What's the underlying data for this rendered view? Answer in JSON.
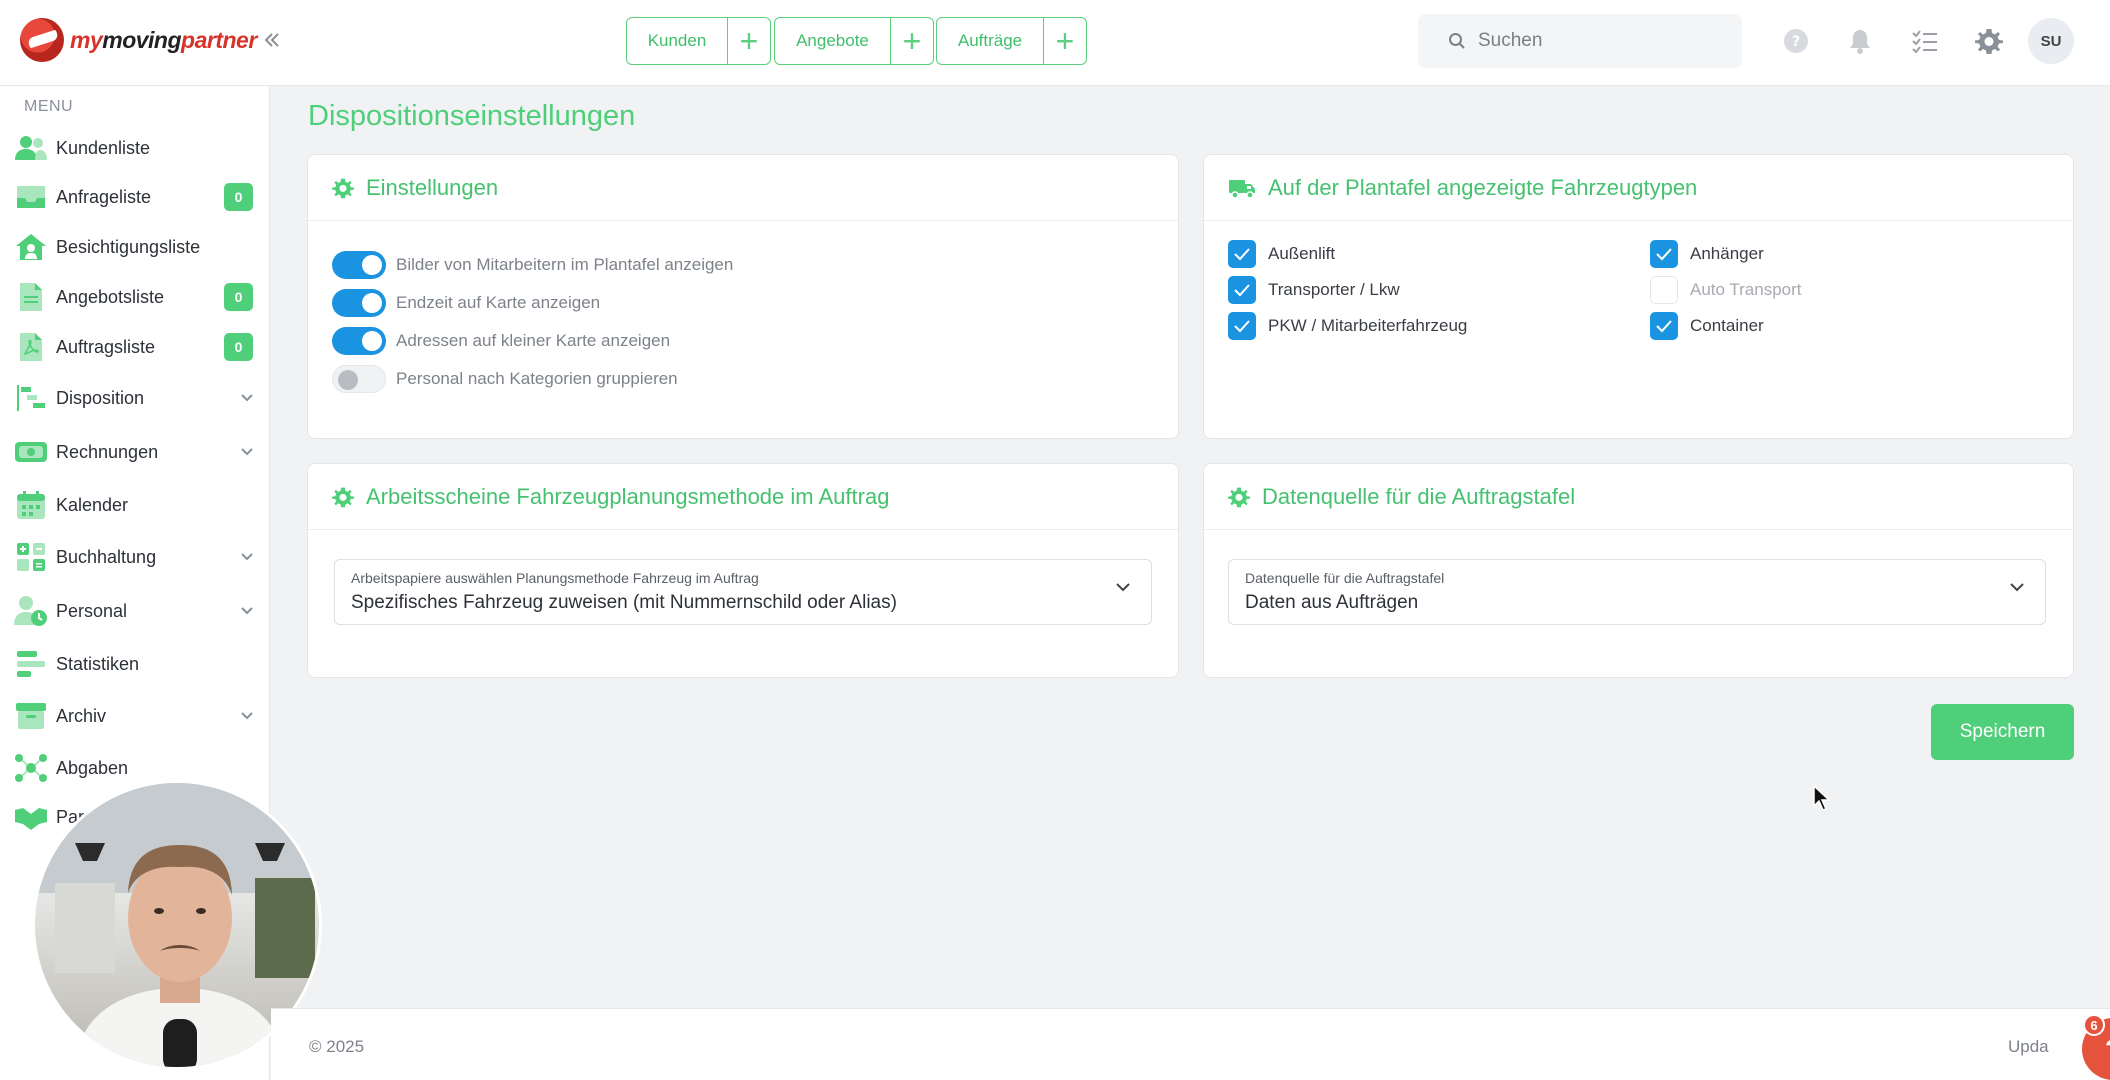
{
  "header": {
    "logo": {
      "part1": "my",
      "part2": "moving",
      "part3": "partner"
    },
    "quick_actions": [
      {
        "label": "Kunden"
      },
      {
        "label": "Angebote"
      },
      {
        "label": "Aufträge"
      }
    ],
    "search_placeholder": "Suchen",
    "avatar_initials": "SU"
  },
  "sidebar": {
    "menu_title": "MENU",
    "items": [
      {
        "label": "Kundenliste",
        "icon": "users-icon"
      },
      {
        "label": "Anfrageliste",
        "icon": "inbox-icon",
        "badge": "0"
      },
      {
        "label": "Besichtigungsliste",
        "icon": "home-icon"
      },
      {
        "label": "Angebotsliste",
        "icon": "document-icon",
        "badge": "0"
      },
      {
        "label": "Auftragsliste",
        "icon": "pdf-icon",
        "badge": "0"
      },
      {
        "label": "Disposition",
        "icon": "gantt-icon",
        "expandable": true
      },
      {
        "label": "Rechnungen",
        "icon": "money-icon",
        "expandable": true
      },
      {
        "label": "Kalender",
        "icon": "calendar-icon"
      },
      {
        "label": "Buchhaltung",
        "icon": "calculator-icon",
        "expandable": true
      },
      {
        "label": "Personal",
        "icon": "staff-icon",
        "expandable": true
      },
      {
        "label": "Statistiken",
        "icon": "stats-icon"
      },
      {
        "label": "Archiv",
        "icon": "archive-icon",
        "expandable": true
      },
      {
        "label": "Abgaben",
        "icon": "network-icon"
      },
      {
        "label": "Par",
        "icon": "handshake-icon"
      }
    ]
  },
  "page": {
    "title": "Dispositionseinstellungen"
  },
  "settings_card": {
    "title": "Einstellungen",
    "toggles": [
      {
        "label": "Bilder von Mitarbeitern im Plantafel anzeigen",
        "on": true
      },
      {
        "label": "Endzeit auf Karte anzeigen",
        "on": true
      },
      {
        "label": "Adressen auf kleiner Karte anzeigen",
        "on": true
      },
      {
        "label": "Personal nach Kategorien gruppieren",
        "on": false
      }
    ]
  },
  "vehicles_card": {
    "title": "Auf der Plantafel angezeigte Fahrzeugtypen",
    "checkboxes": [
      {
        "label": "Außenlift",
        "checked": true
      },
      {
        "label": "Anhänger",
        "checked": true
      },
      {
        "label": "Transporter / Lkw",
        "checked": true
      },
      {
        "label": "Auto Transport",
        "checked": false
      },
      {
        "label": "PKW / Mitarbeiterfahrzeug",
        "checked": true
      },
      {
        "label": "Container",
        "checked": true
      }
    ]
  },
  "worksheet_card": {
    "title": "Arbeitsscheine Fahrzeugplanungsmethode im Auftrag",
    "select_caption": "Arbeitspapiere auswählen Planungsmethode Fahrzeug im Auftrag",
    "select_value": "Spezifisches Fahrzeug zuweisen (mit Nummernschild oder Alias)"
  },
  "datasource_card": {
    "title": "Datenquelle für die Auftragstafel",
    "select_caption": "Datenquelle für die Auftragstafel",
    "select_value": "Daten aus Aufträgen"
  },
  "save_label": "Speichern",
  "footer": {
    "copyright": "© 2025",
    "right_text": "Upda"
  },
  "help": {
    "symbol": "?",
    "count": "6"
  },
  "colors": {
    "accent": "#4fcf7a",
    "toggle_on": "#1a93e0",
    "brand_red": "#d6342a"
  }
}
